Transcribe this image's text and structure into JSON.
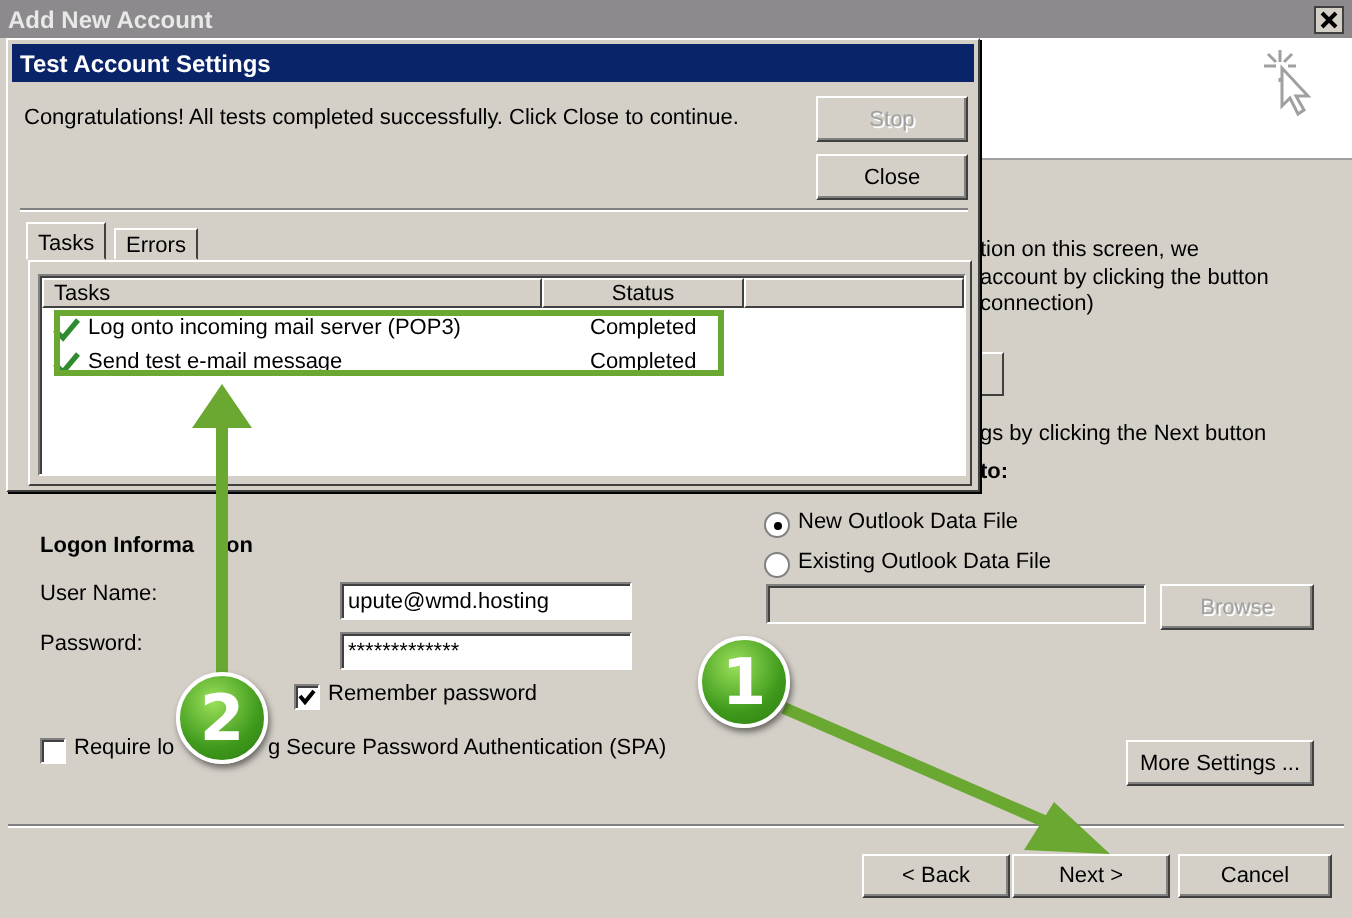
{
  "window": {
    "title": "Add New Account"
  },
  "intro_lines": [
    "tion on this screen, we",
    "account by clicking the button",
    "connection)"
  ],
  "next_hint": "gs by clicking the Next button",
  "deliver_heading": "to:",
  "data_file_options": [
    {
      "label": "New Outlook Data File",
      "selected": true
    },
    {
      "label": "Existing Outlook Data File",
      "selected": false
    }
  ],
  "browse_button": {
    "label": "Browse",
    "disabled": true
  },
  "logon": {
    "heading_parts": [
      "Logon Informa",
      "on"
    ],
    "user_name_label": "User Name:",
    "user_name": "upute@wmd.hosting",
    "password_label": "Password:",
    "password": "*************",
    "remember": {
      "label": "Remember password",
      "checked": true
    },
    "spa": {
      "label_parts": [
        "Require lo",
        "g Secure Password Authentication (SPA)"
      ],
      "checked": false
    }
  },
  "more_settings": {
    "label": "More Settings ..."
  },
  "nav_buttons": [
    {
      "label": "< Back"
    },
    {
      "label": "Next >"
    },
    {
      "label": "Cancel"
    }
  ],
  "dialog": {
    "title": "Test Account Settings",
    "message": "Congratulations! All tests completed successfully. Click Close to continue.",
    "buttons": [
      {
        "label": "Stop",
        "disabled": true
      },
      {
        "label": "Close",
        "disabled": false
      }
    ],
    "tabs": [
      {
        "label": "Tasks",
        "selected": true
      },
      {
        "label": "Errors",
        "selected": false
      }
    ],
    "columns": [
      "Tasks",
      "Status"
    ],
    "rows": [
      {
        "task": "Log onto incoming mail server (POP3)",
        "status": "Completed",
        "done": true
      },
      {
        "task": "Send test e-mail message",
        "status": "Completed",
        "done": true
      }
    ]
  },
  "annotations": [
    {
      "number": "2"
    },
    {
      "number": "1"
    }
  ]
}
